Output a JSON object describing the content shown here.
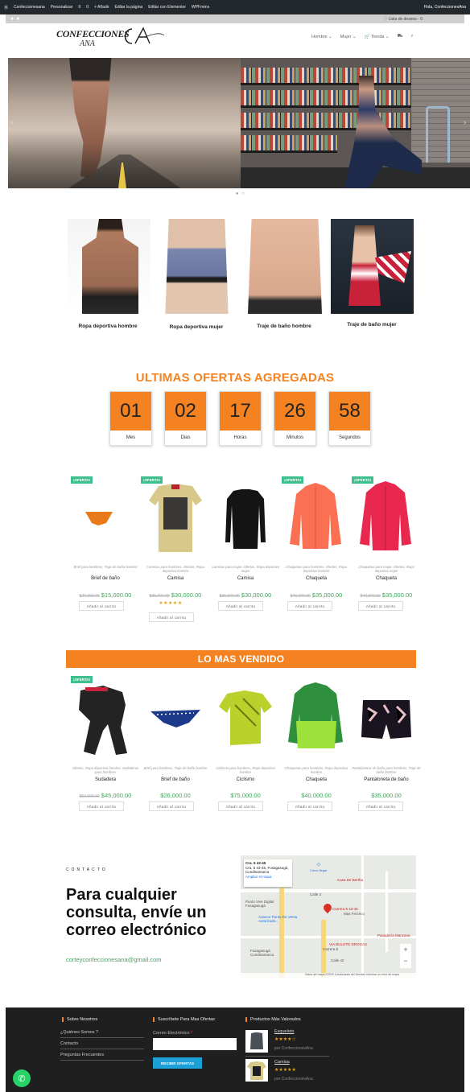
{
  "adminbar": {
    "items": [
      "Confeccionesana",
      "Personalizar",
      "0",
      "0",
      "+ Añadir",
      "Editar la página",
      "Editar con Elementor",
      "WPForms"
    ],
    "user": "Hola, ConfeccionesAna"
  },
  "subbar": {
    "wishlist": "♡ Lista de deseos - 0"
  },
  "header": {
    "logo_line1": "CONFECCIONES",
    "logo_line2": "ANA",
    "logo_mark": "CA",
    "nav": [
      "Hombre ⌄",
      "Mujer ⌄",
      "🛒 Tienda ⌄",
      "⛟",
      "⌕"
    ]
  },
  "categories": [
    {
      "label": "Ropa deportiva hombre"
    },
    {
      "label": "Ropa deportiva mujer"
    },
    {
      "label": "Traje de baño hombre"
    },
    {
      "label": "Traje de baño mujer"
    }
  ],
  "offers": {
    "title": "ULTIMAS OFERTAS AGREGADAS",
    "countdown": [
      {
        "value": "01",
        "label": "Mes"
      },
      {
        "value": "02",
        "label": "Dias"
      },
      {
        "value": "17",
        "label": "Horas"
      },
      {
        "value": "26",
        "label": "Minutos"
      },
      {
        "value": "58",
        "label": "Segundos"
      }
    ],
    "products": [
      {
        "badge": "¡OFERTA!",
        "cats": "Brief para hombres, Traje de baño hombre",
        "name": "Brief de baño",
        "old": "$20,000.00",
        "price": "$15,000.00",
        "btn": "Añadir al carrito"
      },
      {
        "badge": "¡OFERTA!",
        "cats": "Camisas para hombres, Ofertas, Ropa deportiva hombre",
        "name": "Camisa",
        "old": "$35,000.00",
        "price": "$30,000.00",
        "stars": "★★★★★",
        "btn": "Añadir al carrito"
      },
      {
        "badge": "¡OFERTA!",
        "cats": "Camisas para mujer, Ofertas, Ropa deportiva mujer",
        "name": "Camisa",
        "old": "$35,000.00",
        "price": "$30,000.00",
        "btn": "Añadir al carrito"
      },
      {
        "badge": "¡OFERTA!",
        "cats": "Chaquetas para hombres, Ofertas, Ropa deportiva hombre",
        "name": "Chaqueta",
        "old": "$40,000.00",
        "price": "$35,000.00",
        "btn": "Añadir al carrito"
      },
      {
        "badge": "¡OFERTA!",
        "cats": "Chaquetas para mujer, Ofertas, Ropa deportiva mujer",
        "name": "Chaqueta",
        "old": "$40,000.00",
        "price": "$35,000.00",
        "btn": "Añadir al carrito"
      }
    ]
  },
  "bestsellers": {
    "title": "LO MAS VENDIDO",
    "products": [
      {
        "badge": "¡OFERTA!",
        "cats": "Ofertas, Ropa deportiva hombre, Sudaderas para hombres",
        "name": "Sudadera",
        "old": "$50,000.00",
        "price": "$45,000.00",
        "btn": "Añadir al carrito"
      },
      {
        "cats": "Brief para hombres, Traje de baño hombre",
        "name": "Brief de baño",
        "price": "$26,000.00",
        "btn": "Añadir al carrito"
      },
      {
        "cats": "Ciclismo para hombres, Ropa deportiva hombre",
        "name": "Ciclismo",
        "price": "$75,000.00",
        "btn": "Añadir al carrito"
      },
      {
        "cats": "Chaquetas para hombres, Ropa deportiva hombre",
        "name": "Chaqueta",
        "price": "$40,000.00",
        "btn": "Añadir al carrito"
      },
      {
        "cats": "Pantalonetas de baño para hombres, Traje de baño hombre",
        "name": "Pantaloneta de baño",
        "price": "$35,000.00",
        "btn": "Añadir al carrito"
      }
    ]
  },
  "contact": {
    "kicker": "CONTACTO",
    "title": "Para cualquier consulta, envíe un correo electrónico",
    "email": "corteyconfeccionesana@gmail.com"
  },
  "map": {
    "card_title": "Cra. 5 43-45",
    "card_addr": "Cra. 5 43-45, Fusagasugá, Cundinamarca",
    "card_link": "Ampliar el mapa",
    "directions": "Cómo llegar",
    "pin_label": "Carrera 5 43-45",
    "labels": [
      "Punto Vive Digital Fusagasugá",
      "Autocor Punto De Venta Autorizado...",
      "Casa De Bertha",
      "Mas Fecreco",
      "VIA BULOTE DROGAS",
      "Panadería Manzana",
      "Fusagasugá Cundinamarca",
      "Calle 3",
      "Carrera 6",
      "Calle 42"
    ],
    "footer": "Datos del mapa ©2020   Condiciones del Servicio   Informar un error de mapa"
  },
  "footer": {
    "col1_title": "Sobre Nosotros",
    "col1_links": [
      "¿Quiénes Somos ?",
      "Contacto",
      "Preguntas Frecuentes"
    ],
    "col2_title": "Suscríbete Para Mas Ofertas",
    "email_label": "Correo Electrónico",
    "required_mark": "*",
    "subscribe_btn": "RECIBIR OFERTAS",
    "col3_title": "Productos Más Valorados",
    "top_products": [
      {
        "name": "Esqueleto",
        "stars": "★★★★☆",
        "by": "por ConfeccionesAna"
      },
      {
        "name": "Camisa",
        "stars": "★★★★★",
        "by": "por ConfeccionesAna"
      }
    ]
  },
  "colors": {
    "accent": "#f58220",
    "price": "#3aa859",
    "badge": "#3fbf8e",
    "footer": "#1f1f1f"
  }
}
